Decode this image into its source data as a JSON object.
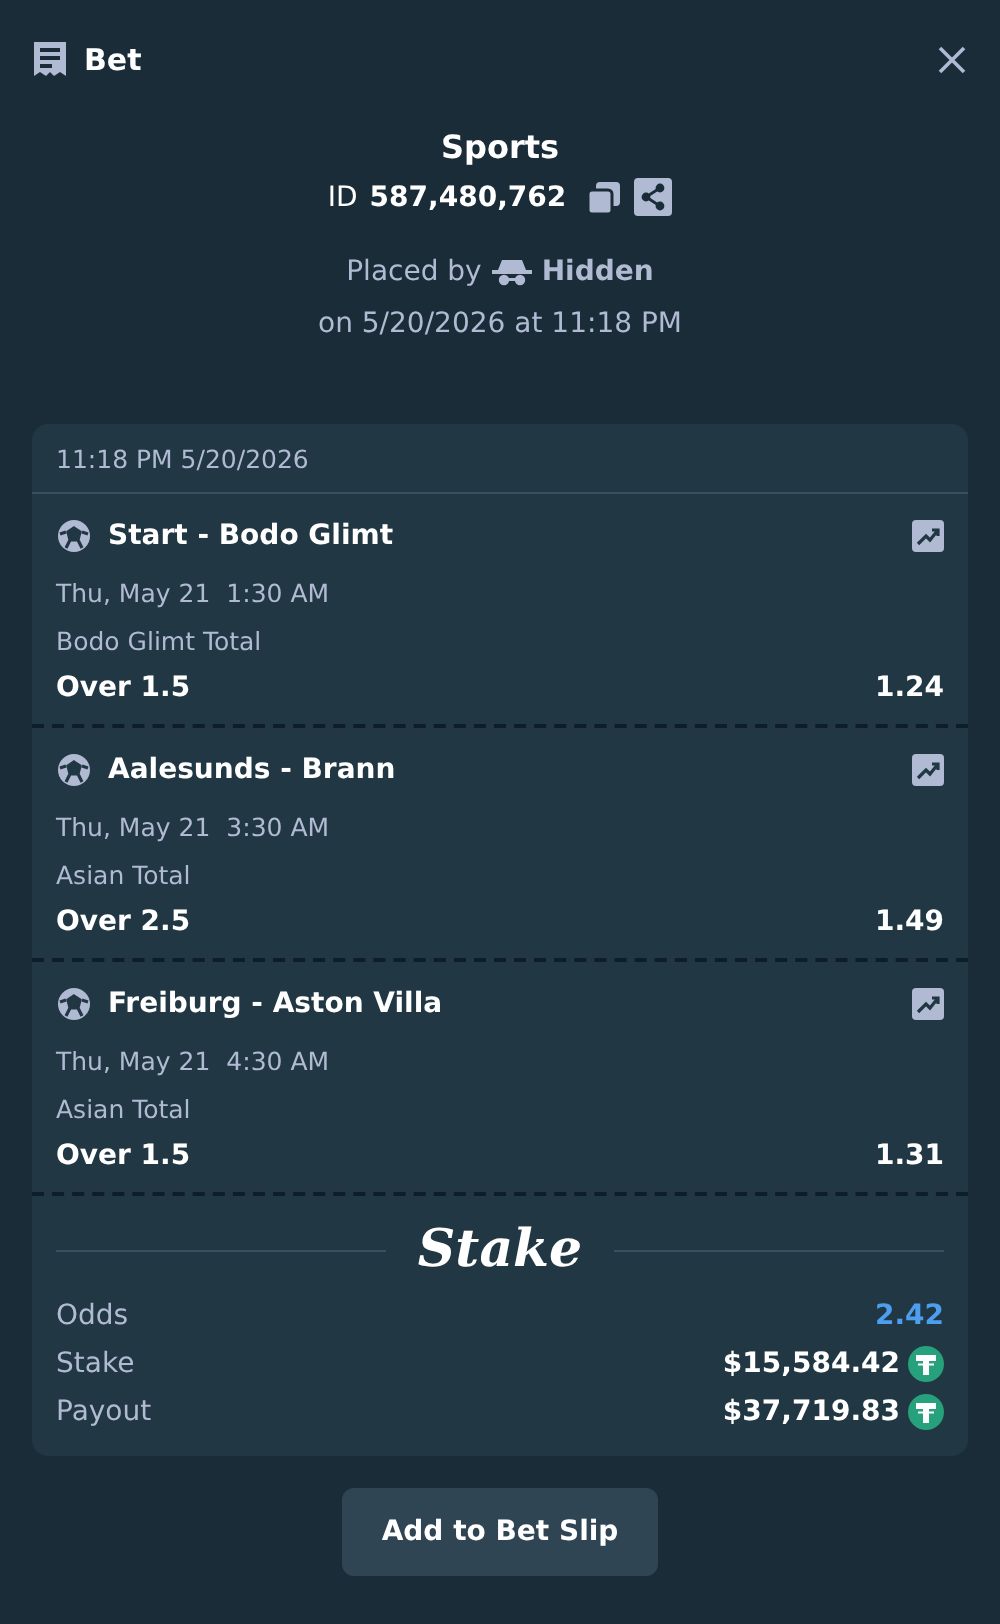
{
  "header": {
    "title": "Bet"
  },
  "bet": {
    "type": "Sports",
    "id_label": "ID",
    "id": "587,480,762",
    "placed_by_label": "Placed by",
    "placed_by": "Hidden",
    "placed_on": "on 5/20/2026 at 11:18 PM"
  },
  "slip": {
    "timestamp": "11:18 PM 5/20/2026",
    "legs": [
      {
        "event": "Start - Bodo Glimt",
        "date": "Thu, May 21",
        "time": "1:30 AM",
        "market": "Bodo Glimt Total",
        "selection": "Over 1.5",
        "odds": "1.24"
      },
      {
        "event": "Aalesunds - Brann",
        "date": "Thu, May 21",
        "time": "3:30 AM",
        "market": "Asian Total",
        "selection": "Over 2.5",
        "odds": "1.49"
      },
      {
        "event": "Freiburg - Aston Villa",
        "date": "Thu, May 21",
        "time": "4:30 AM",
        "market": "Asian Total",
        "selection": "Over 1.5",
        "odds": "1.31"
      }
    ],
    "brand": "Stake",
    "summary": [
      {
        "kind": "odds",
        "label": "Odds",
        "value": "2.42"
      },
      {
        "kind": "amount",
        "label": "Stake",
        "value": "$15,584.42"
      },
      {
        "kind": "amount",
        "label": "Payout",
        "value": "$37,719.83"
      }
    ]
  },
  "button": "Add to Bet Slip"
}
